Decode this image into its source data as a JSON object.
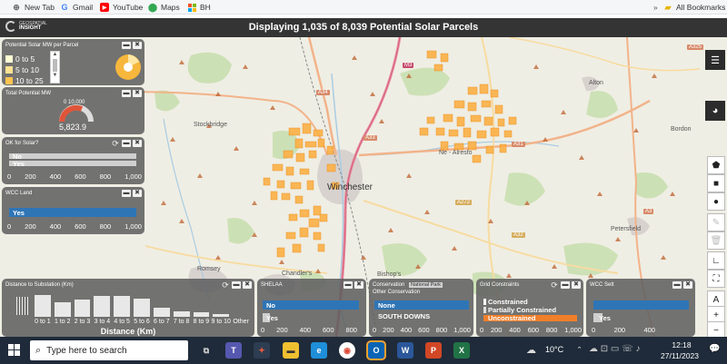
{
  "bookmarks": {
    "items": [
      {
        "label": "New Tab",
        "icon": "new-tab-icon"
      },
      {
        "label": "Gmail",
        "icon": "google-icon"
      },
      {
        "label": "YouTube",
        "icon": "youtube-icon"
      },
      {
        "label": "Maps",
        "icon": "maps-icon"
      },
      {
        "label": "BH",
        "icon": "microsoft-icon"
      }
    ],
    "all_bookmarks": "All Bookmarks"
  },
  "header": {
    "logo_line1": "GEOSPATIAL",
    "logo_line2": "INSIGHT",
    "title": "Displaying 1,035 of 8,039 Potential Solar Parcels"
  },
  "panels": {
    "solar_mw": {
      "title": "Potential Solar MW per Parcel",
      "legend": [
        {
          "label": "0 to 5",
          "color": "#ffffd4"
        },
        {
          "label": "5 to 10",
          "color": "#fee391"
        },
        {
          "label": "10 to 25",
          "color": "#fec44f"
        }
      ]
    },
    "total_mw": {
      "title": "Total Potential MW",
      "value": "5,823.9",
      "gauge_label": "0   10,000"
    },
    "ok_solar": {
      "title": "OK for Solar?",
      "bars": [
        {
          "label": "No",
          "value": 1000
        },
        {
          "label": "Yes",
          "value": 1000
        }
      ],
      "ticks": [
        "0",
        "200",
        "400",
        "600",
        "800",
        "1,000"
      ]
    },
    "wcc_land": {
      "title": "WCC Land",
      "bars": [
        {
          "label": "Yes",
          "value": 1035
        }
      ],
      "ticks": [
        "0",
        "200",
        "400",
        "600",
        "800",
        "1,000"
      ]
    },
    "distance": {
      "title": "Distance to Substation (Km)",
      "categories": [
        "0 to 1",
        "1 to 2",
        "2 to 3",
        "3 to 4",
        "4 to 5",
        "5 to 6",
        "6 to 7",
        "7 to 8",
        "8 to 9",
        "9 to 10",
        "Other"
      ],
      "values": [
        280,
        190,
        220,
        260,
        260,
        230,
        110,
        70,
        60,
        40,
        0
      ],
      "xlabel": "Distance (Km)"
    },
    "shelaa": {
      "title": "SHELAA",
      "bars": [
        {
          "label": "No",
          "value": 1000
        },
        {
          "label": "Yes",
          "value": 60
        }
      ],
      "ticks": [
        "0",
        "200",
        "400",
        "600",
        "800"
      ]
    },
    "conservation": {
      "title1": "Conservation",
      "title1b": "National Park",
      "title2": "Other Conservation",
      "bars": [
        {
          "label": "None",
          "value": 1000
        },
        {
          "label": "SOUTH DOWNS",
          "value": 0
        }
      ],
      "ticks": [
        "0",
        "200",
        "400",
        "600",
        "800",
        "1,000"
      ]
    },
    "grid": {
      "title": "Grid Constraints",
      "bars": [
        {
          "label": "Constrained",
          "value": 0
        },
        {
          "label": "Partially Constrained",
          "value": 0
        },
        {
          "label": "Unconstrained",
          "value": 1000
        }
      ],
      "ticks": [
        "0",
        "200",
        "400",
        "600",
        "800",
        "1,000"
      ]
    },
    "wcc_sett": {
      "title": "WCC Sett",
      "bars": [
        {
          "label": "",
          "value": 1000
        },
        {
          "label": "Yes",
          "value": 100
        }
      ],
      "ticks": [
        "0",
        "200",
        "400"
      ]
    }
  },
  "map": {
    "places": [
      "Stockbridge",
      "Winchester",
      "Alton",
      "Bordon",
      "Ne - Alresfo",
      "Petersfield",
      "Romsey",
      "Chandler's",
      "Bishop's"
    ],
    "roads": [
      "A34",
      "A33",
      "A31",
      "M3",
      "A272",
      "A32",
      "A3",
      "A325",
      "A303",
      "M27"
    ]
  },
  "taskbar": {
    "search_placeholder": "Type here to search",
    "weather": "10°C",
    "time": "12:18",
    "date": "27/11/2023"
  },
  "colors": {
    "header_bg": "#343434",
    "panel_bg": "#5f5f5f",
    "blue_bar": "#2e75b6",
    "orange_bar": "#f07f2a",
    "parcel_fill": "#fcb045"
  }
}
